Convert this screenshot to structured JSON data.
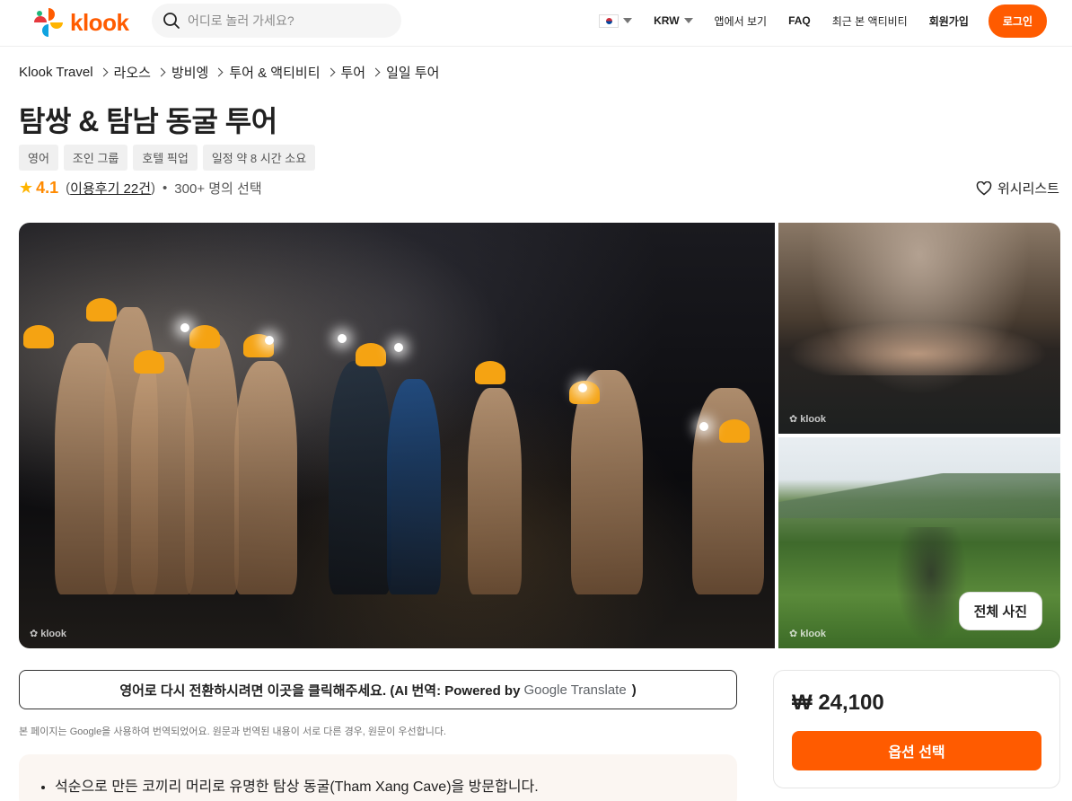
{
  "header": {
    "brand": "klook",
    "search_placeholder": "어디로 놀러 가세요?",
    "currency": "KRW",
    "app_link": "앱에서 보기",
    "faq": "FAQ",
    "recent": "최근 본 액티비티",
    "signup": "회원가입",
    "login": "로그인"
  },
  "breadcrumb": [
    "Klook Travel",
    "라오스",
    "방비엥",
    "투어 & 액티비티",
    "투어",
    "일일 투어"
  ],
  "title": "탐쌍 & 탐남 동굴 투어",
  "tags": [
    "영어",
    "조인 그룹",
    "호텔 픽업",
    "일정 약 8 시간 소요"
  ],
  "rating": {
    "score": "4.1",
    "reviews": "이용후기 22건",
    "booked": "300+ 명의 선택"
  },
  "wishlist": "위시리스트",
  "gallery": {
    "watermark": "klook",
    "view_all": "전체 사진"
  },
  "translate": {
    "message": "영어로 다시 전환하시려면 이곳을 클릭해주세요. (AI 번역: Powered by",
    "google": "Google Translate",
    "close_paren": ")",
    "note": "본 페이지는 Google을 사용하여 번역되었어요. 원문과 번역된 내용이 서로 다른 경우, 원문이 우선합니다."
  },
  "highlights": [
    "석순으로 만든 코끼리 머리로 유명한 탐상 동굴(Tham Xang Cave)을 방문합니다."
  ],
  "price_card": {
    "price": "₩ 24,100",
    "select_button": "옵션 선택"
  },
  "colors": {
    "brand": "#ff5b00",
    "rating": "#ff8a00"
  }
}
